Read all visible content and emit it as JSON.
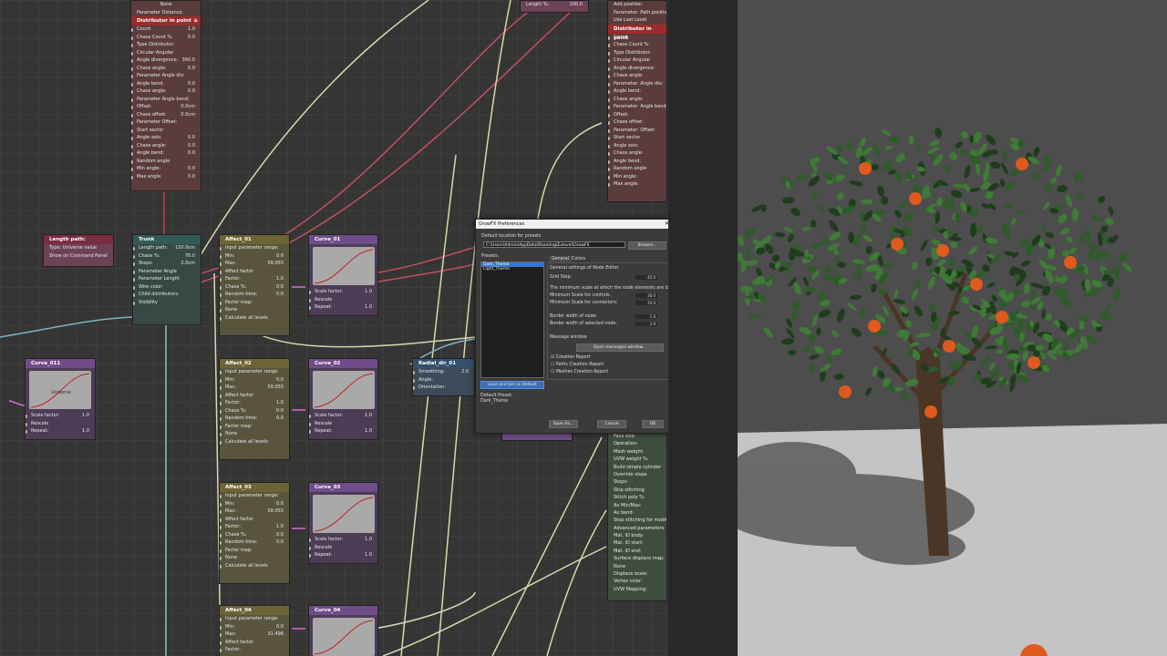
{
  "nodes": {
    "distributor_left": {
      "title": "Distributor in point",
      "rows": [
        "Count:",
        "Chaos Count %:",
        "Type Distributor:",
        "Circular  Angular",
        "Angle divergence:",
        "Chaos angle:",
        "Parameter Angle div:",
        "Angle bend:",
        "Chaos angle:",
        "Parameter Angle bend:",
        "Offset:",
        "Chaos offset:",
        "Parameter Offset:",
        "Start sector",
        "Angle axis:",
        "Chaos angle:",
        "Angle bend:",
        "Random angle",
        "Min angle:",
        "Max angle:"
      ],
      "values": [
        "1.0",
        "0.0",
        "",
        "",
        "360.0",
        "0.0",
        "",
        "0.0",
        "0.0",
        "",
        "0.0cm",
        "0.0cm",
        "",
        "",
        "0.0",
        "0.0",
        "0.0",
        "",
        "0.0",
        "0.0"
      ],
      "top_rows": [
        "None",
        "Parameter Distance:"
      ]
    },
    "length_path": {
      "title": "Length path:",
      "rows": [
        "Type: Universe value",
        "Show on Command Panel"
      ]
    },
    "trunk": {
      "title": "Trunk",
      "rows": [
        "Length path:",
        "Chaos %:",
        "Steps:",
        "Parameter Angle",
        "Parameter Length",
        "Wire color:",
        "Child distributors:",
        "Visibility"
      ],
      "values": [
        "150.0cm",
        "76.0",
        "2.0cm",
        "",
        "",
        "",
        "",
        ""
      ]
    },
    "affect_01": {
      "title": "Affect_01",
      "rows": [
        "Input parameter range:",
        "Min:",
        "Max:",
        "Affect factor",
        "Factor:",
        "Chaos %:",
        "Random time:",
        "Factor map:",
        "None",
        "Calculate all levels"
      ],
      "values": [
        "",
        "0.0",
        "59.055",
        "",
        "1.0",
        "0.0",
        "0.0",
        "",
        "",
        ""
      ]
    },
    "affect_02": {
      "title": "Affect_02",
      "rows": [
        "Input parameter range:",
        "Min:",
        "Max:",
        "Affect factor",
        "Factor:",
        "Chaos %:",
        "Random time:",
        "Factor map:",
        "None",
        "Calculate all levels"
      ],
      "values": [
        "",
        "0.0",
        "59.055",
        "",
        "1.0",
        "0.0",
        "0.0",
        "",
        "",
        ""
      ]
    },
    "affect_03": {
      "title": "Affect_03",
      "rows": [
        "Input parameter range:",
        "Min:",
        "Max:",
        "Affect factor",
        "Factor:",
        "Chaos %:",
        "Random time:",
        "Factor map:",
        "None",
        "Calculate all levels"
      ],
      "values": [
        "",
        "0.0",
        "59.055",
        "",
        "1.0",
        "0.0",
        "0.0",
        "",
        "",
        ""
      ]
    },
    "affect_04": {
      "title": "Affect_04",
      "rows": [
        "Input parameter range:",
        "Min:",
        "Max:",
        "Affect factor",
        "Factor:"
      ],
      "values": [
        "",
        "0.0",
        "31.496",
        "",
        ""
      ]
    },
    "curve_01": {
      "title": "Curve_01",
      "rows": [
        "Scale factor:",
        "Rescale",
        "Repeat:"
      ],
      "values": [
        "1.0",
        "",
        "1.0"
      ]
    },
    "curve_02": {
      "title": "Curve_02",
      "rows": [
        "Scale factor:",
        "Rescale",
        "Repeat:"
      ],
      "values": [
        "1.0",
        "",
        "1.0"
      ]
    },
    "curve_03": {
      "title": "Curve_03",
      "rows": [
        "Scale factor:",
        "Rescale",
        "Repeat:"
      ],
      "values": [
        "1.0",
        "",
        "1.0"
      ]
    },
    "curve_04": {
      "title": "Curve_04",
      "rows": [],
      "values": []
    },
    "curve_011": {
      "title": "Curve_011",
      "curve_label": "Universe",
      "rows": [
        "Scale factor:",
        "Rescale",
        "Repeat:"
      ],
      "values": [
        "1.0",
        "",
        "1.0"
      ]
    },
    "radial_dir": {
      "title": "Radial_dir_01",
      "rows": [
        "Smoothing:",
        "Angle:",
        "Orientation:"
      ],
      "values": [
        "2.0",
        "",
        ""
      ]
    },
    "distributor_right": {
      "title": "Distributor in point",
      "top_rows": [
        "Add position",
        "Parameter: Path position:",
        "Use Last Level"
      ],
      "rows": [
        "Count:",
        "Chaos Count %:",
        "Type Distributor:",
        "Circular  Angular",
        "Angle divergence:",
        "Chaos angle:",
        "Parameter: Angle div:",
        "Angle bend:",
        "Chaos angle:",
        "Parameter: Angle bend:",
        "Offset:",
        "Chaos offset:",
        "Parameter: Offset:",
        "Start sector",
        "Angle axis:",
        "Chaos angle:",
        "Angle bend:",
        "Random angle",
        "Min angle:",
        "Max angle:"
      ]
    },
    "top_length": {
      "row": "Length %:",
      "value": "100.0"
    },
    "right_panel": {
      "rows": [
        "Face size:",
        "Operation:",
        "Mesh weight:",
        "UVW weight %:",
        "Build simple cylinder",
        "Override steps",
        "Steps:",
        "Skip stitching",
        "Stitch poly %:",
        "Ax Min/Max:",
        "Ax bend:",
        "Stop stitching for modifier",
        "Advanced parameters",
        "Mat. ID body:",
        "Mat. ID start:",
        "Mat. ID end:",
        "Surface displace map:",
        "None",
        "Displace scale:",
        "Vertex color:",
        "UVW Mapping:"
      ]
    }
  },
  "dialog": {
    "title": "GrowFX Preferences",
    "close": "✕",
    "default_location_label": "Default location for presets",
    "path": "C:\\Users\\Admin\\AppData\\Roaming\\Exlevel\\GrowFX",
    "browse": "Browse...",
    "presets_label": "Presets:",
    "presets": [
      "Dark_Theme",
      "Light_Theme"
    ],
    "tabs": [
      "General",
      "Colors"
    ],
    "general_settings": "General settings of Node Editor",
    "grid_step_label": "Grid Step:",
    "grid_step": "45.0",
    "min_scale_text": "The minimum scale at which the node elements are locked",
    "min_scale_controls_label": "Minimum Scale for controls:",
    "min_scale_controls": "30.0",
    "min_scale_connectors_label": "Minimum Scale for connectors:",
    "min_scale_connectors": "20.0",
    "border_node_label": "Border width of node:",
    "border_node": "1.0",
    "border_selected_label": "Border width of selected node:",
    "border_selected": "2.0",
    "message_window_label": "Message window",
    "open_messages": "Open messages window...",
    "checks": [
      {
        "label": "Creation Report",
        "checked": true
      },
      {
        "label": "Paths Creation Report",
        "checked": false
      },
      {
        "label": "Meshes Creation Report",
        "checked": false
      }
    ],
    "load_button": "Load and Set as Default",
    "default_preset_label": "Default Preset:",
    "default_preset": "Dark_Theme",
    "save_as": "Save As...",
    "cancel": "Cancel",
    "ok": "OK"
  },
  "colors": {
    "viewport_bg": "#4d4d4d",
    "ground": "#c9c9c9",
    "foliage": "#2f5a2a",
    "orange": "#e0591d",
    "trunk": "#4a3626"
  }
}
